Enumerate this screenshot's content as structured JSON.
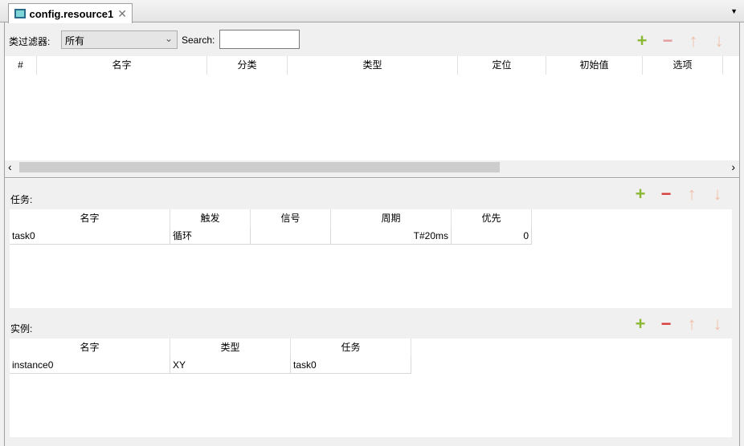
{
  "tab": {
    "title": "config.resource1",
    "close": "✕"
  },
  "filter": {
    "label": "类过滤器:",
    "selected": "所有",
    "search_label": "Search:",
    "search_value": ""
  },
  "variables": {
    "columns": [
      "#",
      "名字",
      "分类",
      "类型",
      "定位",
      "初始值",
      "选项"
    ]
  },
  "tasks": {
    "label": "任务:",
    "columns": [
      "名字",
      "触发",
      "信号",
      "周期",
      "优先"
    ],
    "rows": [
      [
        "task0",
        "循环",
        "",
        "T#20ms",
        "0"
      ]
    ]
  },
  "instances": {
    "label": "实例:",
    "columns": [
      "名字",
      "类型",
      "任务"
    ],
    "rows": [
      [
        "instance0",
        "XY",
        "task0"
      ]
    ]
  },
  "icons": {
    "add": "+",
    "remove": "−",
    "up": "↑",
    "down": "↓",
    "left": "‹",
    "right": "›",
    "dropdown": "⌄",
    "menu": "▼"
  }
}
